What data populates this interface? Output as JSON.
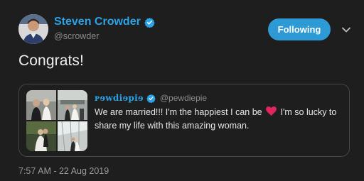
{
  "author": {
    "name": "Steven Crowder",
    "handle": "@scrowder",
    "verified": true
  },
  "follow_button": {
    "label": "Following"
  },
  "tweet": {
    "text": "Congrats!",
    "timestamp": "7:57 AM - 22 Aug 2019"
  },
  "quoted_tweet": {
    "display_name": "ᴘɘwdiɘpiɘ",
    "handle": "@pewdiepie",
    "verified": true,
    "text_before_heart": "We are married!!! I'm the happiest I can be ",
    "text_after_heart": " I'm so lucky to share my life with this amazing woman.",
    "media_count": 4
  },
  "colors": {
    "accent": "#2aa3e8",
    "follow_button_bg": "#2d9ad6",
    "background": "#1e1e1e",
    "heart": "#e0245e"
  }
}
